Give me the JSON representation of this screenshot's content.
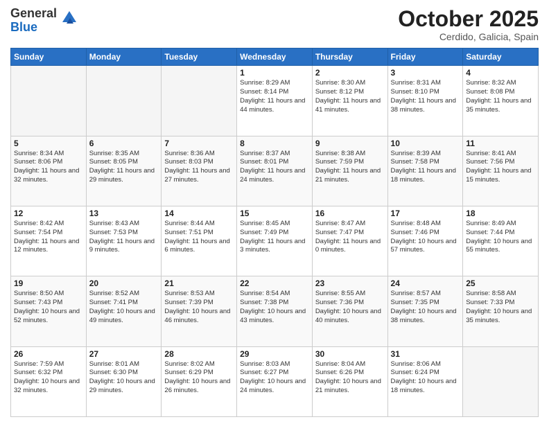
{
  "logo": {
    "general": "General",
    "blue": "Blue"
  },
  "header": {
    "month": "October 2025",
    "location": "Cerdido, Galicia, Spain"
  },
  "days_of_week": [
    "Sunday",
    "Monday",
    "Tuesday",
    "Wednesday",
    "Thursday",
    "Friday",
    "Saturday"
  ],
  "weeks": [
    [
      {
        "day": "",
        "info": ""
      },
      {
        "day": "",
        "info": ""
      },
      {
        "day": "",
        "info": ""
      },
      {
        "day": "1",
        "info": "Sunrise: 8:29 AM\nSunset: 8:14 PM\nDaylight: 11 hours\nand 44 minutes."
      },
      {
        "day": "2",
        "info": "Sunrise: 8:30 AM\nSunset: 8:12 PM\nDaylight: 11 hours\nand 41 minutes."
      },
      {
        "day": "3",
        "info": "Sunrise: 8:31 AM\nSunset: 8:10 PM\nDaylight: 11 hours\nand 38 minutes."
      },
      {
        "day": "4",
        "info": "Sunrise: 8:32 AM\nSunset: 8:08 PM\nDaylight: 11 hours\nand 35 minutes."
      }
    ],
    [
      {
        "day": "5",
        "info": "Sunrise: 8:34 AM\nSunset: 8:06 PM\nDaylight: 11 hours\nand 32 minutes."
      },
      {
        "day": "6",
        "info": "Sunrise: 8:35 AM\nSunset: 8:05 PM\nDaylight: 11 hours\nand 29 minutes."
      },
      {
        "day": "7",
        "info": "Sunrise: 8:36 AM\nSunset: 8:03 PM\nDaylight: 11 hours\nand 27 minutes."
      },
      {
        "day": "8",
        "info": "Sunrise: 8:37 AM\nSunset: 8:01 PM\nDaylight: 11 hours\nand 24 minutes."
      },
      {
        "day": "9",
        "info": "Sunrise: 8:38 AM\nSunset: 7:59 PM\nDaylight: 11 hours\nand 21 minutes."
      },
      {
        "day": "10",
        "info": "Sunrise: 8:39 AM\nSunset: 7:58 PM\nDaylight: 11 hours\nand 18 minutes."
      },
      {
        "day": "11",
        "info": "Sunrise: 8:41 AM\nSunset: 7:56 PM\nDaylight: 11 hours\nand 15 minutes."
      }
    ],
    [
      {
        "day": "12",
        "info": "Sunrise: 8:42 AM\nSunset: 7:54 PM\nDaylight: 11 hours\nand 12 minutes."
      },
      {
        "day": "13",
        "info": "Sunrise: 8:43 AM\nSunset: 7:53 PM\nDaylight: 11 hours\nand 9 minutes."
      },
      {
        "day": "14",
        "info": "Sunrise: 8:44 AM\nSunset: 7:51 PM\nDaylight: 11 hours\nand 6 minutes."
      },
      {
        "day": "15",
        "info": "Sunrise: 8:45 AM\nSunset: 7:49 PM\nDaylight: 11 hours\nand 3 minutes."
      },
      {
        "day": "16",
        "info": "Sunrise: 8:47 AM\nSunset: 7:47 PM\nDaylight: 11 hours\nand 0 minutes."
      },
      {
        "day": "17",
        "info": "Sunrise: 8:48 AM\nSunset: 7:46 PM\nDaylight: 10 hours\nand 57 minutes."
      },
      {
        "day": "18",
        "info": "Sunrise: 8:49 AM\nSunset: 7:44 PM\nDaylight: 10 hours\nand 55 minutes."
      }
    ],
    [
      {
        "day": "19",
        "info": "Sunrise: 8:50 AM\nSunset: 7:43 PM\nDaylight: 10 hours\nand 52 minutes."
      },
      {
        "day": "20",
        "info": "Sunrise: 8:52 AM\nSunset: 7:41 PM\nDaylight: 10 hours\nand 49 minutes."
      },
      {
        "day": "21",
        "info": "Sunrise: 8:53 AM\nSunset: 7:39 PM\nDaylight: 10 hours\nand 46 minutes."
      },
      {
        "day": "22",
        "info": "Sunrise: 8:54 AM\nSunset: 7:38 PM\nDaylight: 10 hours\nand 43 minutes."
      },
      {
        "day": "23",
        "info": "Sunrise: 8:55 AM\nSunset: 7:36 PM\nDaylight: 10 hours\nand 40 minutes."
      },
      {
        "day": "24",
        "info": "Sunrise: 8:57 AM\nSunset: 7:35 PM\nDaylight: 10 hours\nand 38 minutes."
      },
      {
        "day": "25",
        "info": "Sunrise: 8:58 AM\nSunset: 7:33 PM\nDaylight: 10 hours\nand 35 minutes."
      }
    ],
    [
      {
        "day": "26",
        "info": "Sunrise: 7:59 AM\nSunset: 6:32 PM\nDaylight: 10 hours\nand 32 minutes."
      },
      {
        "day": "27",
        "info": "Sunrise: 8:01 AM\nSunset: 6:30 PM\nDaylight: 10 hours\nand 29 minutes."
      },
      {
        "day": "28",
        "info": "Sunrise: 8:02 AM\nSunset: 6:29 PM\nDaylight: 10 hours\nand 26 minutes."
      },
      {
        "day": "29",
        "info": "Sunrise: 8:03 AM\nSunset: 6:27 PM\nDaylight: 10 hours\nand 24 minutes."
      },
      {
        "day": "30",
        "info": "Sunrise: 8:04 AM\nSunset: 6:26 PM\nDaylight: 10 hours\nand 21 minutes."
      },
      {
        "day": "31",
        "info": "Sunrise: 8:06 AM\nSunset: 6:24 PM\nDaylight: 10 hours\nand 18 minutes."
      },
      {
        "day": "",
        "info": ""
      }
    ]
  ]
}
